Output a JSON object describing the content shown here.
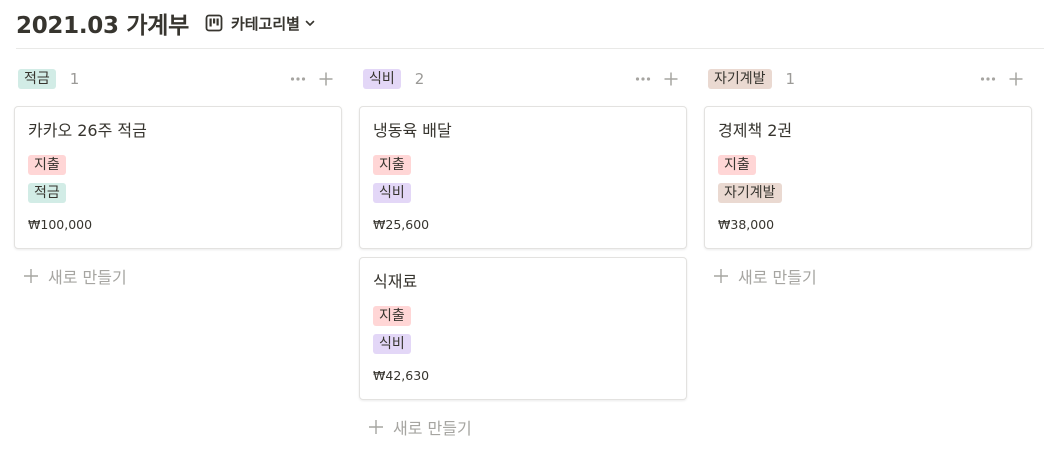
{
  "page": {
    "title": "2021.03 가계부",
    "view_label": "카테고리별"
  },
  "colors": {
    "tag_expense": "#ffd6d6",
    "tag_savings": "#d2ece6",
    "tag_food": "#e3d7f7",
    "tag_selfdev": "#ead9d1",
    "muted": "#9b9a97"
  },
  "icons": {
    "view": "board-icon",
    "dropdown": "chevron-down-icon",
    "more": "more-icon",
    "add": "plus-icon"
  },
  "new_label": "새로 만들기",
  "columns": [
    {
      "label": "적금",
      "color": "#d2ece6",
      "count": "1",
      "cards": [
        {
          "title": "카카오 26주 적금",
          "tags": [
            {
              "label": "지출",
              "color": "#ffd6d6"
            },
            {
              "label": "적금",
              "color": "#d2ece6"
            }
          ],
          "price": "₩100,000"
        }
      ]
    },
    {
      "label": "식비",
      "color": "#e3d7f7",
      "count": "2",
      "cards": [
        {
          "title": "냉동육 배달",
          "tags": [
            {
              "label": "지출",
              "color": "#ffd6d6"
            },
            {
              "label": "식비",
              "color": "#e3d7f7"
            }
          ],
          "price": "₩25,600"
        },
        {
          "title": "식재료",
          "tags": [
            {
              "label": "지출",
              "color": "#ffd6d6"
            },
            {
              "label": "식비",
              "color": "#e3d7f7"
            }
          ],
          "price": "₩42,630"
        }
      ]
    },
    {
      "label": "자기계발",
      "color": "#ead9d1",
      "count": "1",
      "cards": [
        {
          "title": "경제책 2권",
          "tags": [
            {
              "label": "지출",
              "color": "#ffd6d6"
            },
            {
              "label": "자기계발",
              "color": "#ead9d1"
            }
          ],
          "price": "₩38,000"
        }
      ]
    }
  ]
}
